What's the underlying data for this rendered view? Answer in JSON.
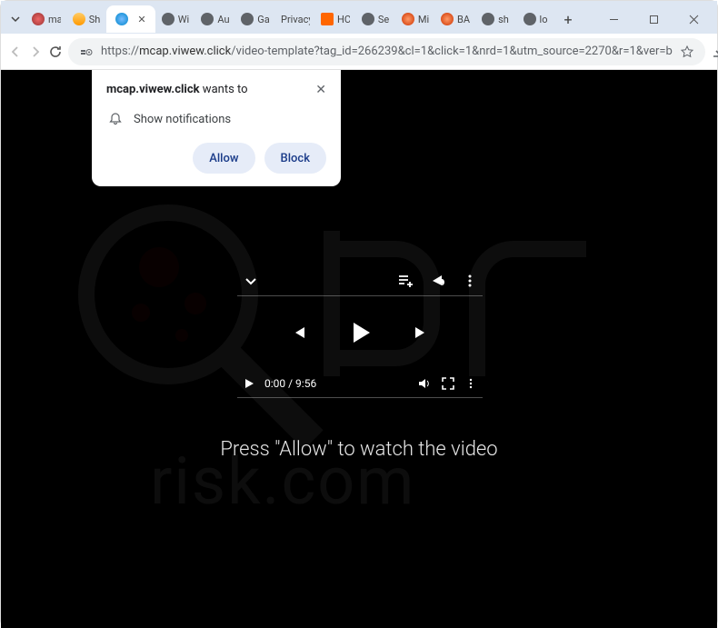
{
  "tabs": {
    "items": [
      {
        "label": "ma"
      },
      {
        "label": "Sh"
      },
      {
        "label": ""
      },
      {
        "label": "Wi"
      },
      {
        "label": "Au"
      },
      {
        "label": "Ga"
      },
      {
        "label": "Privacy"
      },
      {
        "label": "HC"
      },
      {
        "label": "Se"
      },
      {
        "label": "Mi"
      },
      {
        "label": "BA"
      },
      {
        "label": "sh"
      },
      {
        "label": "lo"
      }
    ],
    "active_index": 2
  },
  "address_bar": {
    "scheme": "https://",
    "host": "mcap.viwew.click",
    "path": "/video-template?tag_id=266239&cl=1&click=1&nrd=1&utm_source=2270&r=1&ver=b"
  },
  "permission": {
    "site": "mcap.viwew.click",
    "wants": " wants to",
    "prompt": "Show notifications",
    "allow": "Allow",
    "block": "Block"
  },
  "player": {
    "current": "0:00",
    "sep": " / ",
    "total": "9:56"
  },
  "page": {
    "message": "Press \"Allow\" to watch the video"
  }
}
